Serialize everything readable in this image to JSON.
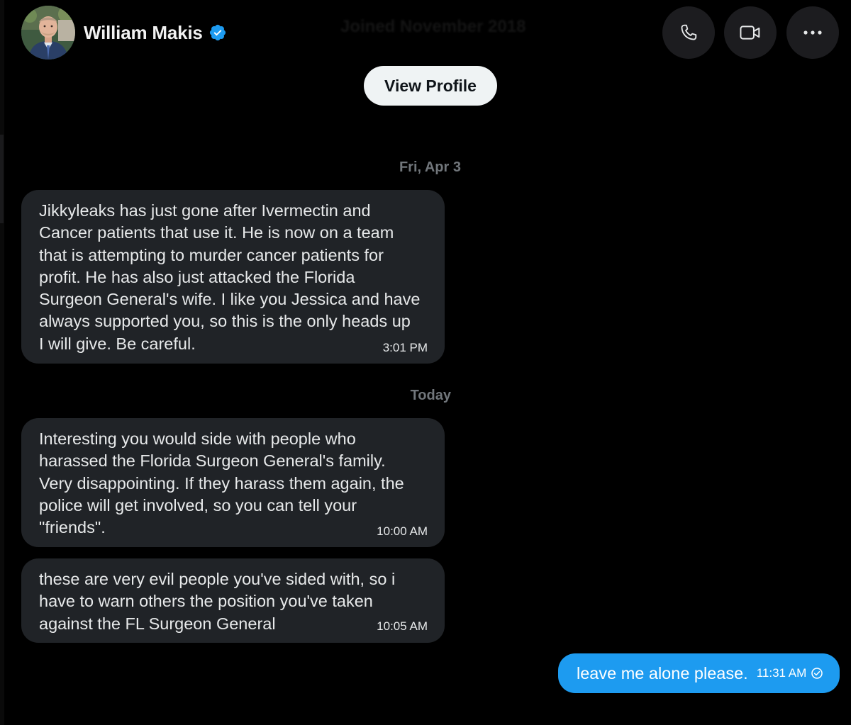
{
  "header": {
    "user_name": "William Makis",
    "avatar_icon": "profile-photo",
    "verified_icon": "verified-badge-icon",
    "joined_text": "Joined November 2018",
    "call_icon": "phone-icon",
    "video_icon": "video-camera-icon",
    "more_icon": "more-horizontal-icon"
  },
  "view_profile_label": "View Profile",
  "colors": {
    "background": "#000000",
    "received_bubble": "#202327",
    "sent_bubble": "#1d9bf0",
    "verified_badge": "#1d9bf0",
    "secondary_text": "#71767b"
  },
  "conversation": {
    "groups": [
      {
        "date_label": "Fri, Apr 3",
        "messages": [
          {
            "direction": "received",
            "text": "Jikkyleaks has just gone after Ivermectin and\nCancer patients that use it. He is now on a team\nthat is attempting to murder cancer patients for\nprofit. He has also just attacked the Florida\nSurgeon General's wife. I like you Jessica and have\nalways supported you, so this is the only heads up\nI will give. Be careful.",
            "time": "3:01 PM"
          }
        ]
      },
      {
        "date_label": "Today",
        "messages": [
          {
            "direction": "received",
            "text": "Interesting you would side with people who\nharassed the Florida Surgeon General's family.\nVery disappointing. If they harass them again, the\npolice will get involved, so you can tell your\n\"friends\".",
            "time": "10:00 AM"
          },
          {
            "direction": "received",
            "text": "these are very evil people you've sided with, so i\nhave to warn others the position you've taken\nagainst the FL Surgeon General",
            "time": "10:05 AM"
          },
          {
            "direction": "sent",
            "text": "leave me alone please.",
            "time": "11:31 AM",
            "status_icon": "read-receipt-check-icon"
          }
        ]
      }
    ]
  }
}
